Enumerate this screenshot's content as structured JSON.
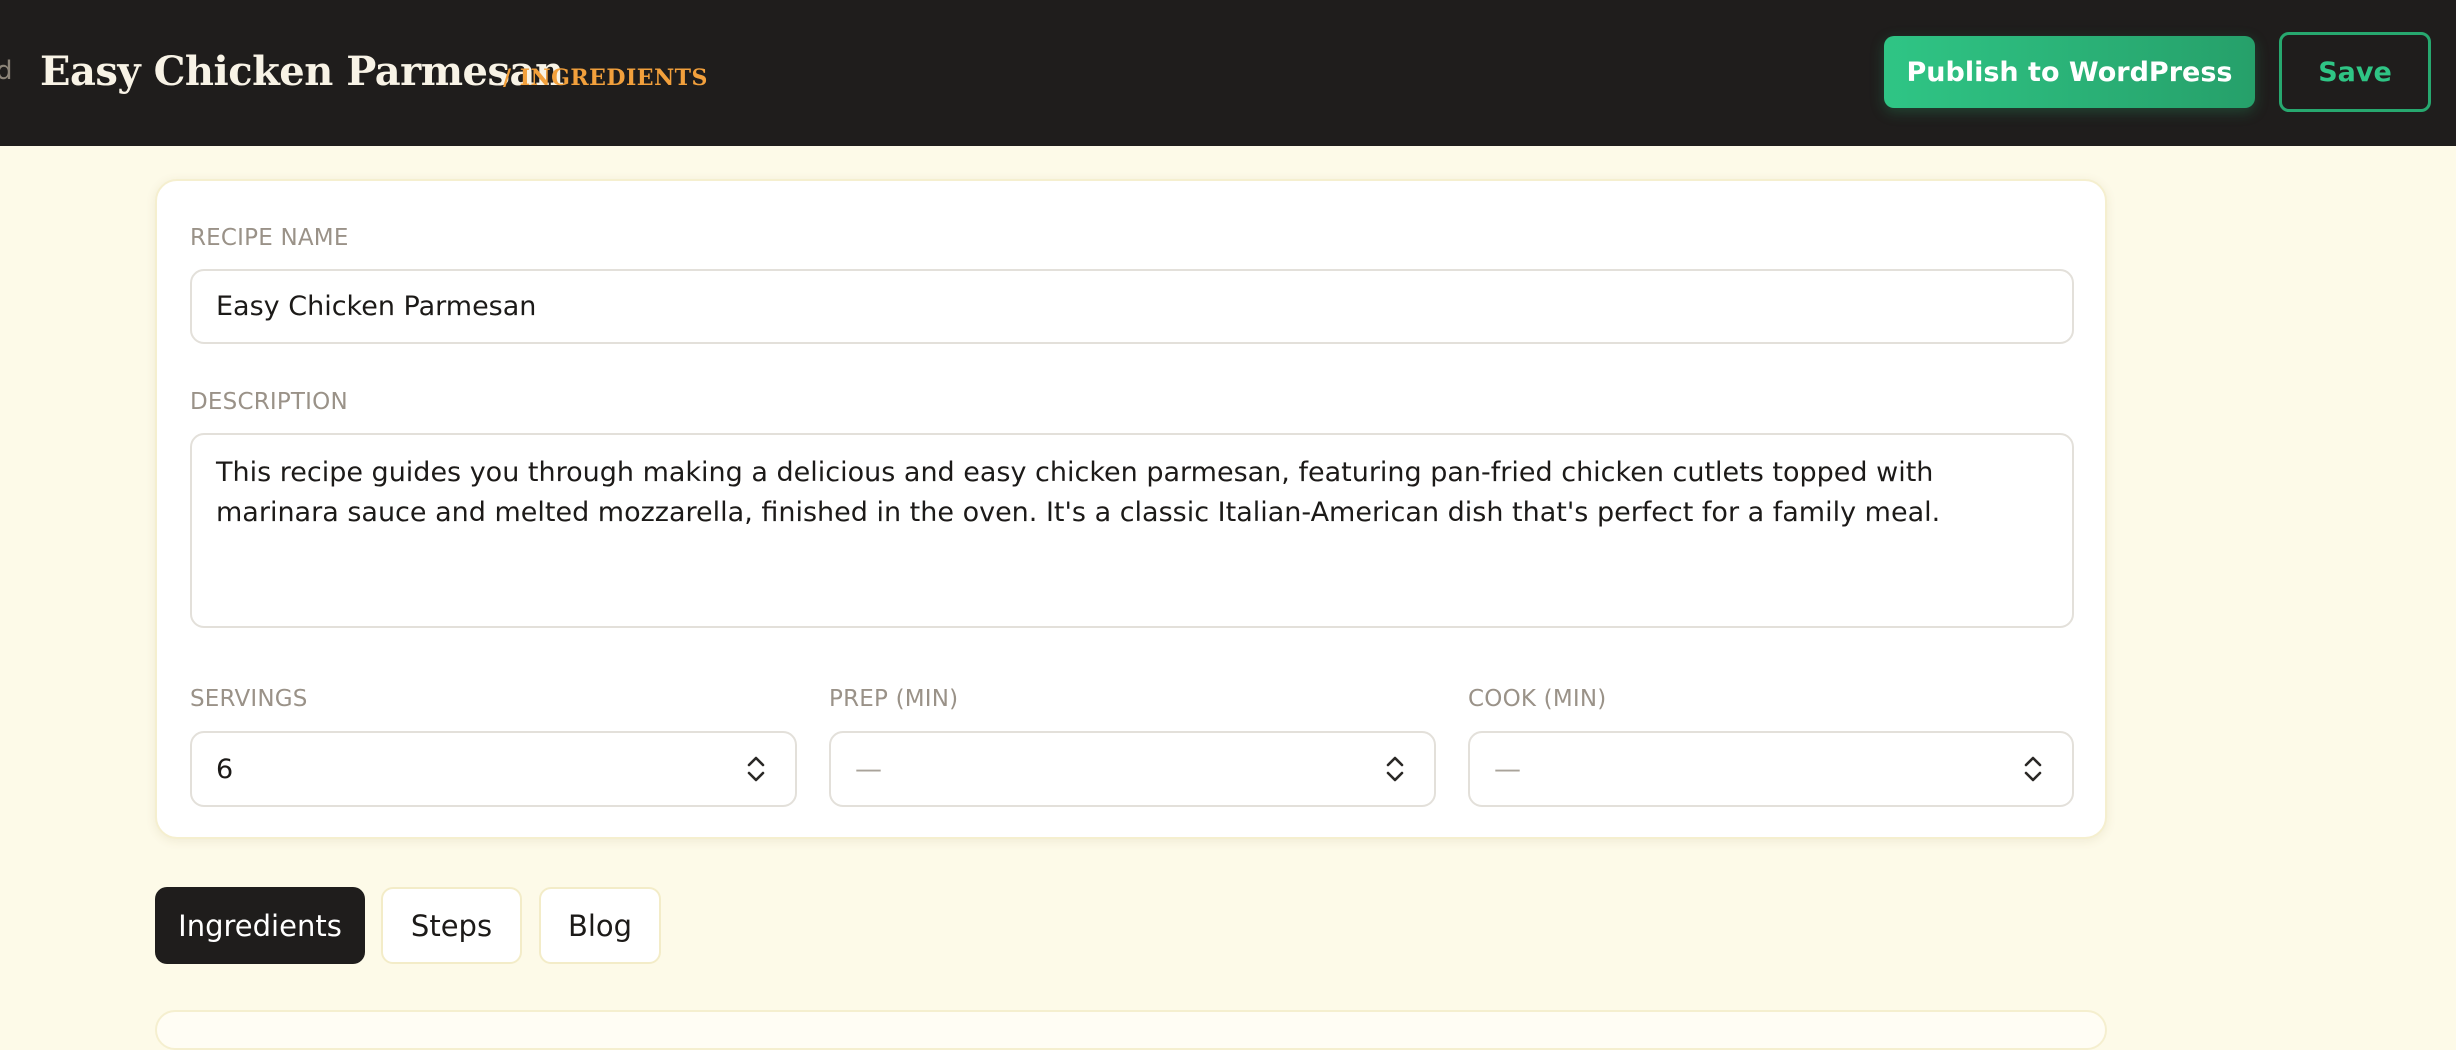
{
  "header": {
    "back_fragment": "d",
    "title": "Easy Chicken Parmesan",
    "breadcrumb": "/ INGREDIENTS",
    "publish_label": "Publish to WordPress",
    "save_label": "Save"
  },
  "form": {
    "recipe_name": {
      "label": "RECIPE NAME",
      "value": "Easy Chicken Parmesan"
    },
    "description": {
      "label": "DESCRIPTION",
      "value": "This recipe guides you through making a delicious and easy chicken parmesan, featuring pan-fried chicken cutlets topped with marinara sauce and melted mozzarella, finished in the oven. It's a classic Italian-American dish that's perfect for a family meal."
    },
    "servings": {
      "label": "SERVINGS",
      "value": "6"
    },
    "prep": {
      "label": "PREP (MIN)",
      "placeholder": "—"
    },
    "cook": {
      "label": "COOK (MIN)",
      "placeholder": "—"
    }
  },
  "tabs": [
    {
      "label": "Ingredients",
      "active": true
    },
    {
      "label": "Steps",
      "active": false
    },
    {
      "label": "Blog",
      "active": false
    }
  ],
  "colors": {
    "page_bg": "#fdfae8",
    "header_bg": "#1f1d1c",
    "accent_orange": "#f2a03c",
    "accent_green": "#2fc585"
  },
  "icons": {
    "stepper": "chevron-up-down-icon"
  }
}
